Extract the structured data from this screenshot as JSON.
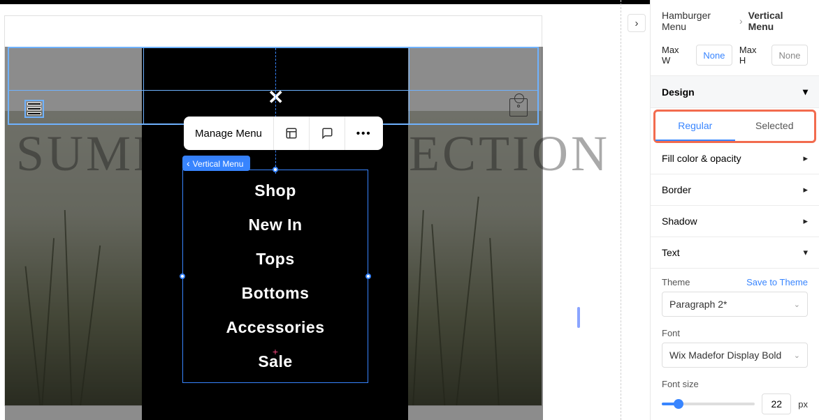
{
  "breadcrumb": {
    "parent": "Hamburger Menu",
    "current": "Vertical Menu"
  },
  "max": {
    "w_label": "Max W",
    "w_value": "None",
    "h_label": "Max H",
    "h_value": "None"
  },
  "design": {
    "header": "Design",
    "tabs": {
      "regular": "Regular",
      "selected": "Selected"
    },
    "rows": {
      "fill": "Fill color & opacity",
      "border": "Border",
      "shadow": "Shadow",
      "text": "Text"
    },
    "theme": {
      "label": "Theme",
      "save": "Save to Theme",
      "value": "Paragraph 2*"
    },
    "font": {
      "label": "Font",
      "value": "Wix Madefor Display Bold"
    },
    "fontsize": {
      "label": "Font size",
      "value": "22",
      "unit": "px"
    }
  },
  "toolbar": {
    "manage": "Manage Menu"
  },
  "badge": {
    "label": "Vertical Menu"
  },
  "menu_items": [
    "Shop",
    "New In",
    "Tops",
    "Bottoms",
    "Accessories",
    "Sale"
  ],
  "hero_title": "SUMMER COLLECTION"
}
